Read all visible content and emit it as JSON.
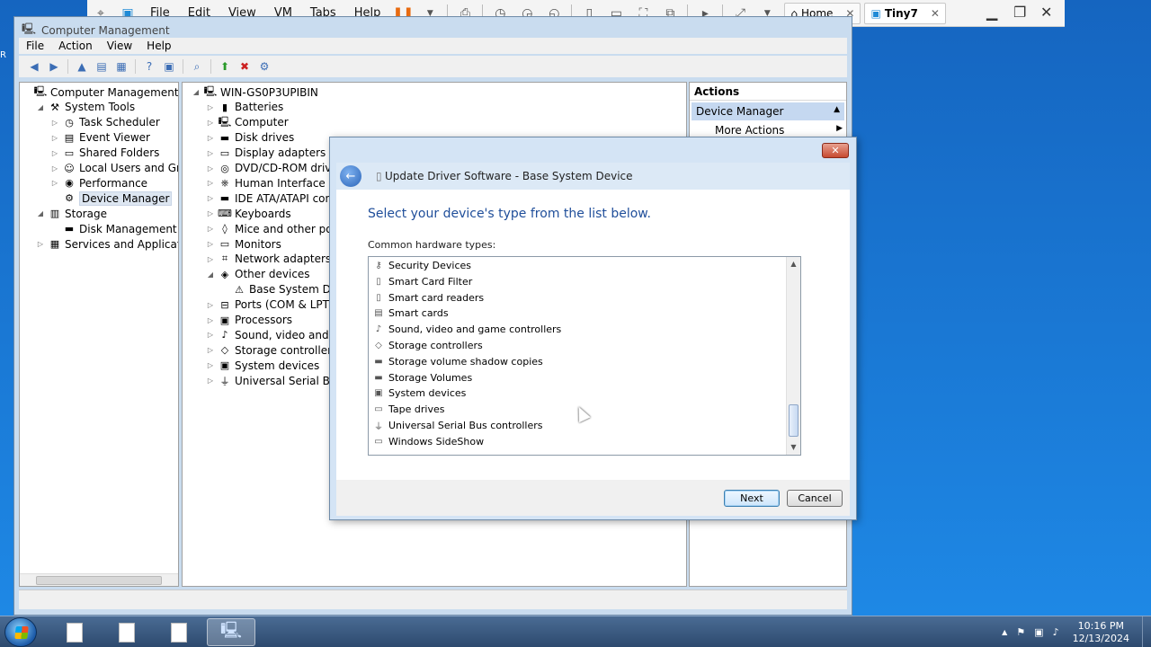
{
  "vmware": {
    "menus": [
      "File",
      "Edit",
      "View",
      "VM",
      "Tabs",
      "Help"
    ],
    "tabs": [
      {
        "label": "Home",
        "icon": "home-icon",
        "close": "✕"
      },
      {
        "label": "Tiny7",
        "icon": "vm-icon",
        "close": "✕"
      }
    ]
  },
  "cm": {
    "title": "Computer Management",
    "menus": [
      "File",
      "Action",
      "View",
      "Help"
    ],
    "left_tree": [
      {
        "label": "Computer Management (Local",
        "level": 0,
        "arrow": "",
        "icon": "computer-management-icon"
      },
      {
        "label": "System Tools",
        "level": 1,
        "arrow": "◢",
        "icon": "system-tools-icon"
      },
      {
        "label": "Task Scheduler",
        "level": 2,
        "arrow": "▷",
        "icon": "clock-icon"
      },
      {
        "label": "Event Viewer",
        "level": 2,
        "arrow": "▷",
        "icon": "event-viewer-icon"
      },
      {
        "label": "Shared Folders",
        "level": 2,
        "arrow": "▷",
        "icon": "folder-icon"
      },
      {
        "label": "Local Users and Groups",
        "level": 2,
        "arrow": "▷",
        "icon": "users-icon"
      },
      {
        "label": "Performance",
        "level": 2,
        "arrow": "▷",
        "icon": "performance-icon"
      },
      {
        "label": "Device Manager",
        "level": 2,
        "arrow": "",
        "icon": "device-manager-icon",
        "selected": true
      },
      {
        "label": "Storage",
        "level": 1,
        "arrow": "◢",
        "icon": "storage-icon"
      },
      {
        "label": "Disk Management",
        "level": 2,
        "arrow": "",
        "icon": "disk-icon"
      },
      {
        "label": "Services and Applications",
        "level": 1,
        "arrow": "▷",
        "icon": "services-icon"
      }
    ],
    "device_tree": [
      {
        "label": "WIN-GS0P3UPIBIN",
        "level": 0,
        "arrow": "◢",
        "icon": "computer-icon"
      },
      {
        "label": "Batteries",
        "level": 1,
        "arrow": "▷",
        "icon": "battery-icon"
      },
      {
        "label": "Computer",
        "level": 1,
        "arrow": "▷",
        "icon": "computer-icon"
      },
      {
        "label": "Disk drives",
        "level": 1,
        "arrow": "▷",
        "icon": "disk-icon"
      },
      {
        "label": "Display adapters",
        "level": 1,
        "arrow": "▷",
        "icon": "display-icon"
      },
      {
        "label": "DVD/CD-ROM drives",
        "level": 1,
        "arrow": "▷",
        "icon": "dvd-icon"
      },
      {
        "label": "Human Interface Dev",
        "level": 1,
        "arrow": "▷",
        "icon": "hid-icon"
      },
      {
        "label": "IDE ATA/ATAPI contr",
        "level": 1,
        "arrow": "▷",
        "icon": "ide-icon"
      },
      {
        "label": "Keyboards",
        "level": 1,
        "arrow": "▷",
        "icon": "keyboard-icon"
      },
      {
        "label": "Mice and other point",
        "level": 1,
        "arrow": "▷",
        "icon": "mouse-icon"
      },
      {
        "label": "Monitors",
        "level": 1,
        "arrow": "▷",
        "icon": "monitor-icon"
      },
      {
        "label": "Network adapters",
        "level": 1,
        "arrow": "▷",
        "icon": "network-icon"
      },
      {
        "label": "Other devices",
        "level": 1,
        "arrow": "◢",
        "icon": "other-devices-icon"
      },
      {
        "label": "Base System Devic",
        "level": 2,
        "arrow": "",
        "icon": "warning-device-icon"
      },
      {
        "label": "Ports (COM & LPT)",
        "level": 1,
        "arrow": "▷",
        "icon": "port-icon"
      },
      {
        "label": "Processors",
        "level": 1,
        "arrow": "▷",
        "icon": "processor-icon"
      },
      {
        "label": "Sound, video and gar",
        "level": 1,
        "arrow": "▷",
        "icon": "sound-icon"
      },
      {
        "label": "Storage controllers",
        "level": 1,
        "arrow": "▷",
        "icon": "storage-controller-icon"
      },
      {
        "label": "System devices",
        "level": 1,
        "arrow": "▷",
        "icon": "system-devices-icon"
      },
      {
        "label": "Universal Serial Bus c",
        "level": 1,
        "arrow": "▷",
        "icon": "usb-icon"
      }
    ],
    "actions": {
      "header": "Actions",
      "section": "Device Manager",
      "item": "More Actions"
    }
  },
  "dialog": {
    "title": "Update Driver Software - Base System Device",
    "close": "✕",
    "heading": "Select your device's type from the list below.",
    "list_label": "Common hardware types:",
    "items": [
      {
        "label": "Security Devices",
        "icon": "key-icon"
      },
      {
        "label": "Smart Card Filter",
        "icon": "smart-card-filter-icon"
      },
      {
        "label": "Smart card readers",
        "icon": "smart-card-reader-icon"
      },
      {
        "label": "Smart cards",
        "icon": "smart-card-icon"
      },
      {
        "label": "Sound, video and game controllers",
        "icon": "speaker-icon"
      },
      {
        "label": "Storage controllers",
        "icon": "storage-controller-icon"
      },
      {
        "label": "Storage volume shadow copies",
        "icon": "drive-icon"
      },
      {
        "label": "Storage Volumes",
        "icon": "drive-icon"
      },
      {
        "label": "System devices",
        "icon": "system-devices-icon"
      },
      {
        "label": "Tape drives",
        "icon": "tape-drive-icon"
      },
      {
        "label": "Universal Serial Bus controllers",
        "icon": "usb-icon"
      },
      {
        "label": "Windows SideShow",
        "icon": "sideshow-icon"
      }
    ],
    "next_label": "Next",
    "cancel_label": "Cancel"
  },
  "taskbar": {
    "time": "10:16 PM",
    "date": "12/13/2024"
  }
}
